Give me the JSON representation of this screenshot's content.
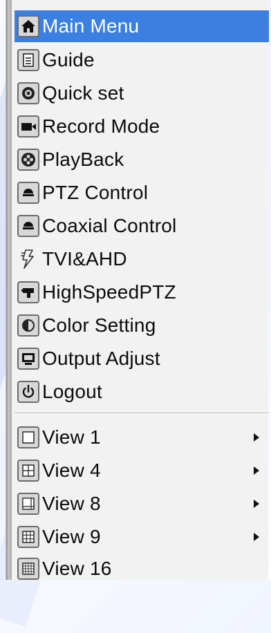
{
  "menu": {
    "items": [
      {
        "label": "Main Menu",
        "icon": "home-icon",
        "active": true
      },
      {
        "label": "Guide",
        "icon": "document-icon"
      },
      {
        "label": "Quick set",
        "icon": "quick-set-icon"
      },
      {
        "label": "Record Mode",
        "icon": "camera-icon"
      },
      {
        "label": "PlayBack",
        "icon": "playback-icon"
      },
      {
        "label": "PTZ Control",
        "icon": "dome-camera-icon"
      },
      {
        "label": "Coaxial Control",
        "icon": "dome-camera-icon"
      },
      {
        "label": "TVI&AHD",
        "icon": "lightning-icon"
      },
      {
        "label": "HighSpeedPTZ",
        "icon": "ptz-camera-icon"
      },
      {
        "label": "Color Setting",
        "icon": "contrast-icon"
      },
      {
        "label": "Output Adjust",
        "icon": "monitor-icon"
      },
      {
        "label": "Logout",
        "icon": "power-icon"
      }
    ],
    "views": [
      {
        "label": "View 1",
        "icon": "layout-1-icon",
        "submenu": true
      },
      {
        "label": "View 4",
        "icon": "layout-4-icon",
        "submenu": true
      },
      {
        "label": "View 8",
        "icon": "layout-8-icon",
        "submenu": true
      },
      {
        "label": "View 9",
        "icon": "layout-9-icon",
        "submenu": true
      },
      {
        "label": "View 16",
        "icon": "layout-16-icon",
        "submenu": false
      }
    ]
  },
  "colors": {
    "highlight": "#3b7fe0",
    "menu_background": "#f2f2f2",
    "icon_border": "#6a6a6a"
  }
}
